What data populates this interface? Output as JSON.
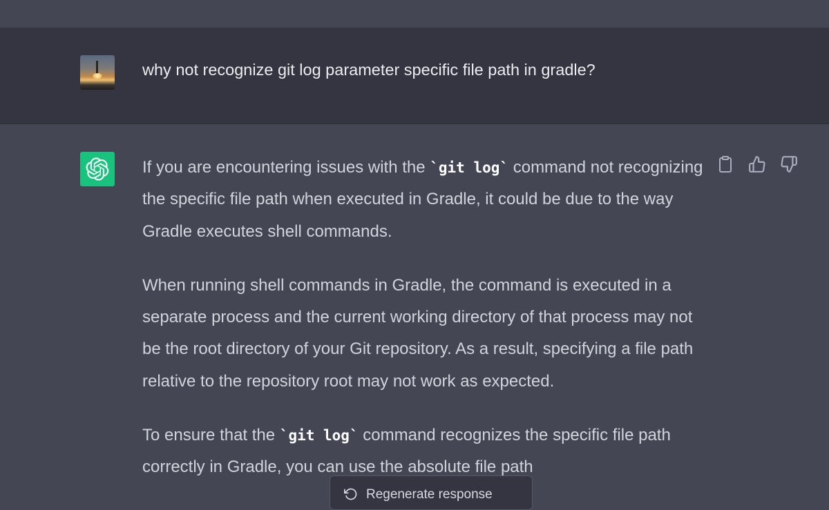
{
  "conversation": {
    "user_message": "why not recognize git log parameter specific file path in gradle?",
    "assistant": {
      "paragraphs": [
        {
          "parts": [
            {
              "t": "If you are encountering issues with the "
            },
            {
              "t": "`git log`",
              "code": true
            },
            {
              "t": " command not recognizing the specific file path when executed in Gradle, it could be due to the way Gradle executes shell commands."
            }
          ]
        },
        {
          "parts": [
            {
              "t": "When running shell commands in Gradle, the command is executed in a separate process and the current working directory of that process may not be the root directory of your Git repository. As a result, specifying a file path relative to the repository root may not work as expected."
            }
          ]
        },
        {
          "parts": [
            {
              "t": "To ensure that the "
            },
            {
              "t": "`git log`",
              "code": true
            },
            {
              "t": " command recognizes the specific file path correctly in Gradle, you can use the absolute file path"
            }
          ]
        }
      ]
    }
  },
  "actions": {
    "copy_icon": "clipboard-icon",
    "like_icon": "thumbs-up-icon",
    "dislike_icon": "thumbs-down-icon"
  },
  "regenerate": {
    "label": "Regenerate response",
    "icon": "refresh-icon"
  },
  "colors": {
    "user_bg": "#343541",
    "assistant_bg": "#444654",
    "gpt_green": "#19c37d",
    "text": "#d1d5db"
  }
}
